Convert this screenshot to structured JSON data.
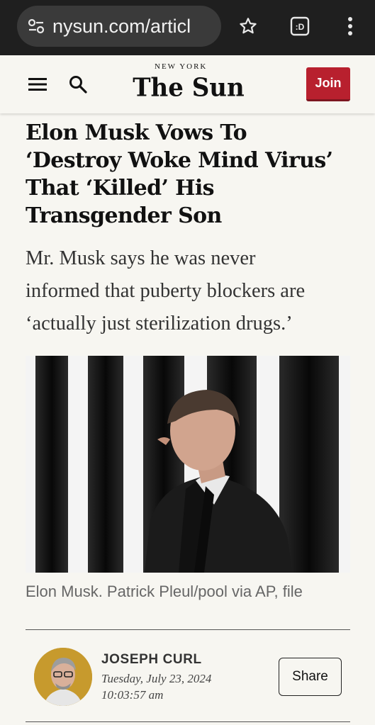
{
  "browser": {
    "url": "nysun.com/articl",
    "icons": [
      "tune-icon",
      "star-icon",
      "tab-switcher-icon",
      "overflow-menu-icon"
    ],
    "tab_label": ":D"
  },
  "header": {
    "logo_top": "NEW YORK",
    "logo_main": "The Sun",
    "join_label": "Join",
    "accent_color": "#b8202e"
  },
  "article": {
    "headline_lines": [
      "Elon Musk Vows To",
      "‘Destroy Woke Mind Virus’",
      "That ‘Killed’ His",
      "Transgender Son"
    ],
    "dek_lines": [
      "Mr. Musk says he was never",
      "informed that puberty blockers are",
      "‘actually just sterilization drugs.’"
    ],
    "caption": "Elon Musk. Patrick Pleul/pool via AP, file",
    "author": "JOSEPH CURL",
    "date": "Tuesday, July 23, 2024",
    "time": "10:03:57 am",
    "share_label": "Share"
  }
}
